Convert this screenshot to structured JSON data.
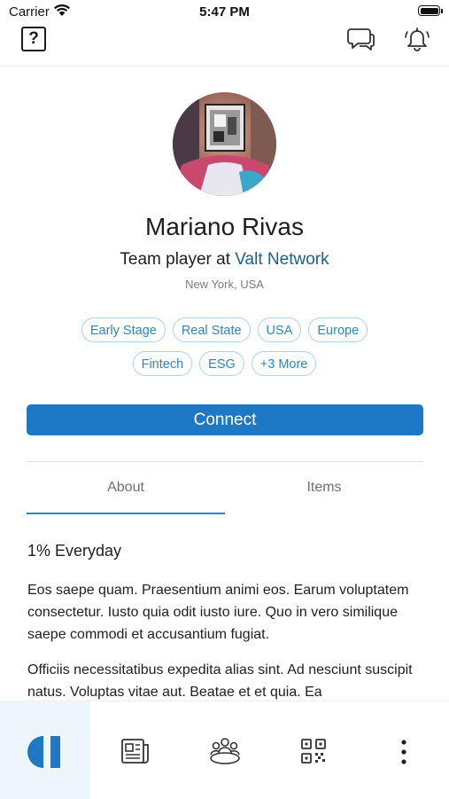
{
  "status_bar": {
    "carrier": "Carrier",
    "time": "5:47 PM"
  },
  "top_bar": {
    "help_label": "?",
    "icons": [
      "help-icon",
      "chat-icon",
      "bell-icon"
    ]
  },
  "profile": {
    "name": "Mariano Rivas",
    "headline_prefix": "Team player at ",
    "company": "Valt Network",
    "location": "New York, USA",
    "tags_row1": [
      "Early Stage",
      "Real State",
      "USA",
      "Europe"
    ],
    "tags_row2": [
      "Fintech",
      "ESG",
      "+3 More"
    ],
    "connect_label": "Connect"
  },
  "tabs": {
    "about": "About",
    "items": "Items",
    "active": "about"
  },
  "about": {
    "title": "1% Everyday",
    "paragraph1": "Eos saepe quam. Praesentium animi eos. Earum voluptatem consectetur. Iusto quia odit iusto iure. Quo in vero similique saepe commodi et accusantium fugiat.",
    "paragraph2": "Officiis necessitatibus expedita alias sint. Ad nesciunt suscipit natus. Voluptas vitae aut. Beatae et et quia. Ea"
  },
  "bottom_nav": {
    "items": [
      "logo-icon",
      "news-icon",
      "community-icon",
      "qr-code-icon",
      "more-icon"
    ],
    "active": "logo-icon"
  },
  "colors": {
    "accent": "#1f78c4",
    "company": "#1d5f8a",
    "tag_text": "#2c86c4",
    "tag_border": "#a9d3ee"
  }
}
